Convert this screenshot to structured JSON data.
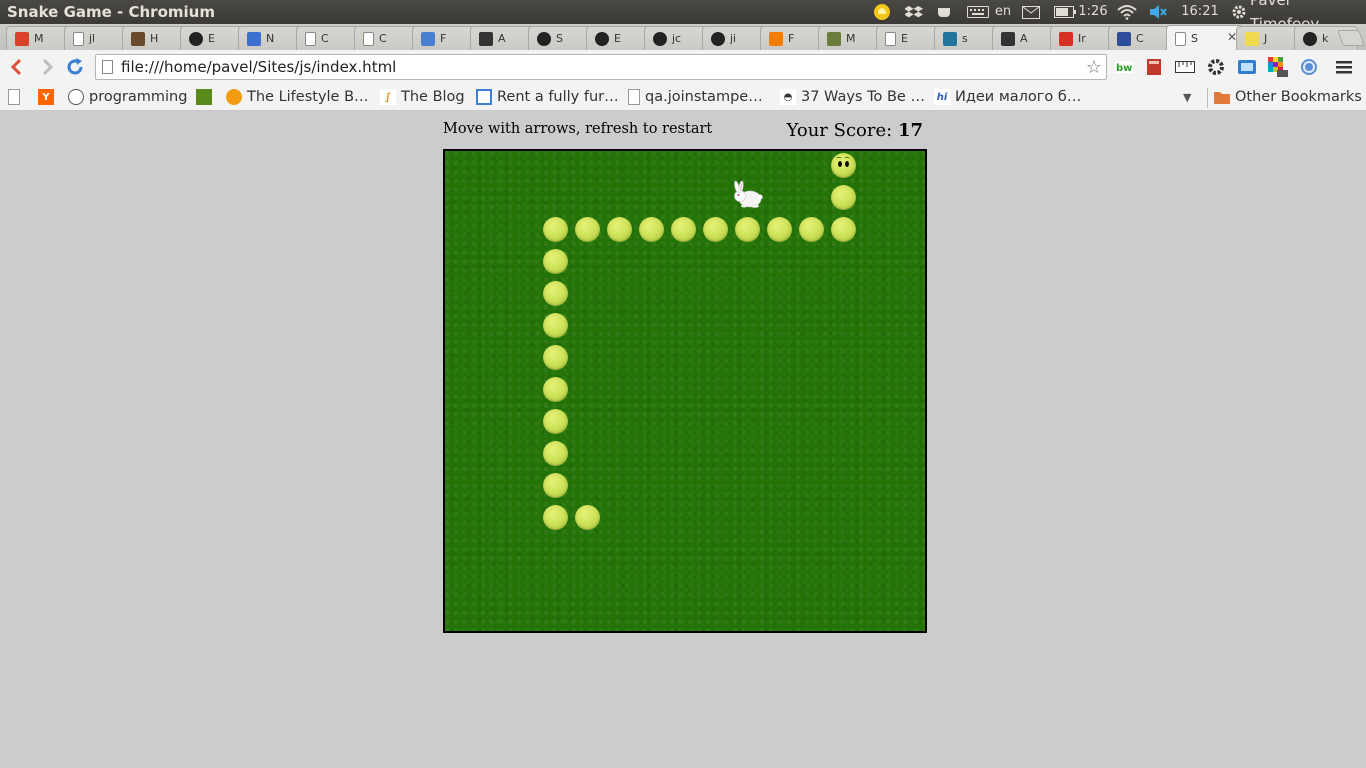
{
  "os": {
    "window_title": "Snake Game - Chromium",
    "keyboard_layout": "en",
    "battery_time": "1:26",
    "clock": "16:21",
    "user_name": "Pavel Timofeev"
  },
  "tabs": [
    {
      "label": "M",
      "icon": "basketball-icon",
      "color": "#d9412b"
    },
    {
      "label": "jl",
      "icon": "page-icon",
      "color": "#ffffff"
    },
    {
      "label": "H",
      "icon": "horse-icon",
      "color": "#6b4a2b"
    },
    {
      "label": "E",
      "icon": "github-icon",
      "color": "#222222"
    },
    {
      "label": "N",
      "icon": "html5-icon",
      "color": "#3d6fd1"
    },
    {
      "label": "C",
      "icon": "page-icon",
      "color": "#ffffff"
    },
    {
      "label": "C",
      "icon": "page-icon",
      "color": "#ffffff"
    },
    {
      "label": "F",
      "icon": "h-icon",
      "color": "#4a7fd0"
    },
    {
      "label": "A",
      "icon": "o-icon",
      "color": "#333333"
    },
    {
      "label": "S",
      "icon": "github-icon",
      "color": "#222222"
    },
    {
      "label": "E",
      "icon": "github-icon",
      "color": "#222222"
    },
    {
      "label": "jc",
      "icon": "github-icon",
      "color": "#222222"
    },
    {
      "label": "ji",
      "icon": "github-icon",
      "color": "#222222"
    },
    {
      "label": "F",
      "icon": "blogger-icon",
      "color": "#f57d00"
    },
    {
      "label": "M",
      "icon": "figure-icon",
      "color": "#6b7d3a"
    },
    {
      "label": "E",
      "icon": "page-icon",
      "color": "#ffffff"
    },
    {
      "label": "s",
      "icon": "wordpress-icon",
      "color": "#21759b"
    },
    {
      "label": "A",
      "icon": "o-icon",
      "color": "#333333"
    },
    {
      "label": "Ir",
      "icon": "gmail-icon",
      "color": "#d93025"
    },
    {
      "label": "C",
      "icon": "person-icon",
      "color": "#2b4d9b"
    },
    {
      "label": "S",
      "icon": "page-icon",
      "color": "#ffffff",
      "active": true
    },
    {
      "label": "J",
      "icon": "js-icon",
      "color": "#f0db4f"
    },
    {
      "label": "k",
      "icon": "github-icon",
      "color": "#222222"
    }
  ],
  "toolbar": {
    "url": "file:///home/pavel/Sites/js/index.html"
  },
  "bookmarks": {
    "items": [
      {
        "label": "",
        "icon": "page-icon"
      },
      {
        "label": "",
        "icon": "ycombinator-icon"
      },
      {
        "label": "programming",
        "icon": "reddit-icon"
      },
      {
        "label": "",
        "icon": "mountain-icon"
      },
      {
        "label": "The Lifestyle B…",
        "icon": "sun-icon"
      },
      {
        "label": "The Blog",
        "icon": "swirl-icon"
      },
      {
        "label": "Rent a fully fur…",
        "icon": "calendar-icon"
      },
      {
        "label": "qa.joinstampe…",
        "icon": "page-icon"
      },
      {
        "label": "37 Ways To Be …",
        "icon": "man-icon"
      },
      {
        "label": "Идеи малого б…",
        "icon": "hi-icon"
      }
    ],
    "other": "Other Bookmarks"
  },
  "game": {
    "instructions": "Move with arrows, refresh to restart",
    "score_label": "Your Score:",
    "score": 17,
    "grid_size": 15,
    "snake": [
      [
        12,
        0
      ],
      [
        12,
        1
      ],
      [
        12,
        2
      ],
      [
        11,
        2
      ],
      [
        10,
        2
      ],
      [
        9,
        2
      ],
      [
        8,
        2
      ],
      [
        7,
        2
      ],
      [
        6,
        2
      ],
      [
        5,
        2
      ],
      [
        4,
        2
      ],
      [
        3,
        2
      ],
      [
        3,
        3
      ],
      [
        3,
        4
      ],
      [
        3,
        5
      ],
      [
        3,
        6
      ],
      [
        3,
        7
      ],
      [
        3,
        8
      ],
      [
        3,
        9
      ],
      [
        3,
        10
      ],
      [
        3,
        11
      ],
      [
        4,
        11
      ]
    ],
    "rabbit": [
      9,
      1
    ],
    "colors": {
      "board": "#237307",
      "snake": "#cfe35a",
      "background": "#cccccc"
    }
  }
}
